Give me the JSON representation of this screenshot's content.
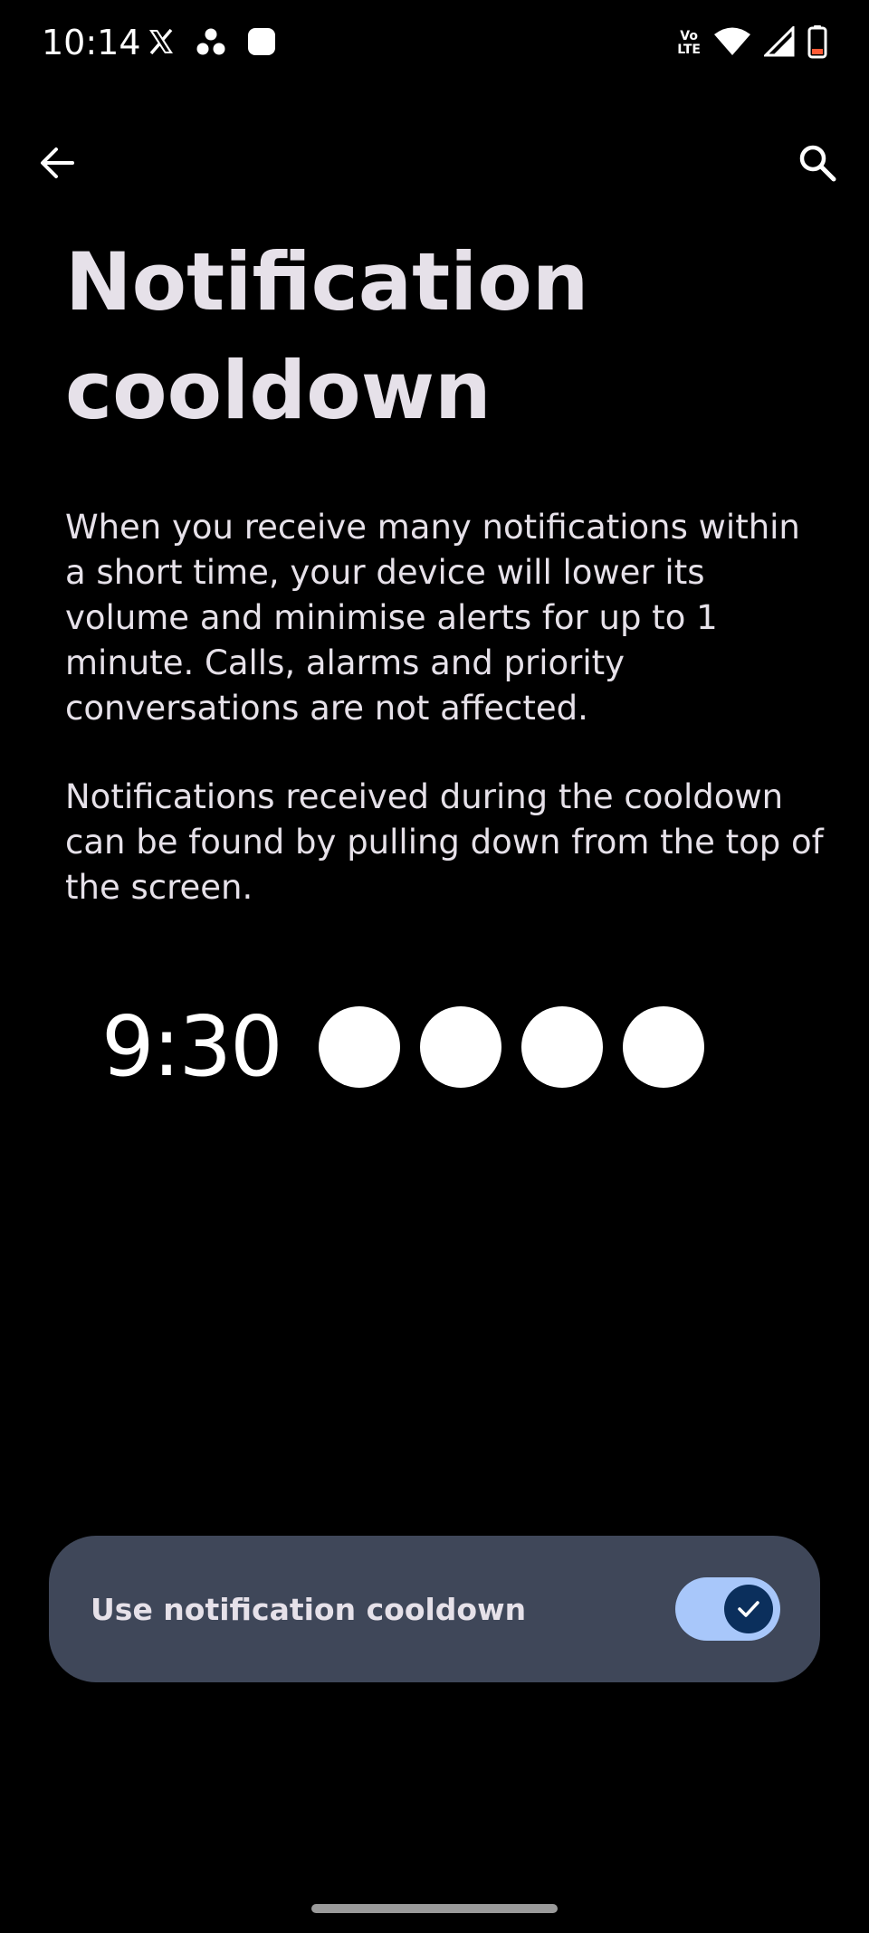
{
  "status_bar": {
    "time": "10:14",
    "left_icons": [
      "x-app-icon",
      "hub-icon",
      "square-app-icon"
    ],
    "right_icons": [
      "volte-icon",
      "wifi-icon",
      "signal-icon",
      "battery-icon"
    ],
    "volte_top": "Vo",
    "volte_bottom": "LTE"
  },
  "top_bar": {
    "back_icon": "arrow-back-icon",
    "search_icon": "search-icon"
  },
  "page": {
    "title": "Notification cooldown",
    "description_1": "When you receive many notifications within a short time, your device will lower its volume and minimise alerts for up to 1 minute. Calls, alarms and priority conversations are not affected.",
    "description_2": "Notifications received during the cooldown can be found by pulling down from the top of the screen."
  },
  "illustration": {
    "time": "9:30",
    "dots": 4
  },
  "toggle": {
    "label": "Use notification cooldown",
    "checked": true
  },
  "colors": {
    "background": "#000000",
    "text": "#e6e1e9",
    "card": "#3f4759",
    "switch_track": "#a8c7fa",
    "switch_thumb": "#0b2f5c"
  }
}
